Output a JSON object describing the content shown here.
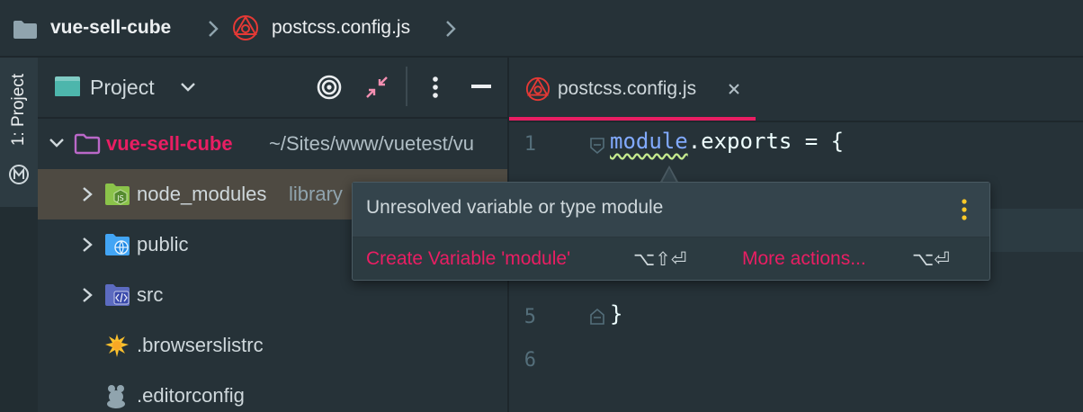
{
  "breadcrumb": {
    "project": "vue-sell-cube",
    "file": "postcss.config.js"
  },
  "toolstrip": {
    "project_tab": "1: Project"
  },
  "project_panel": {
    "title": "Project",
    "tree": [
      {
        "name": "vue-sell-cube",
        "path": "~/Sites/www/vuetest/vu"
      },
      {
        "name": "node_modules",
        "suffix": "library"
      },
      {
        "name": "public"
      },
      {
        "name": "src"
      },
      {
        "name": ".browserslistrc"
      },
      {
        "name": ".editorconfig"
      }
    ]
  },
  "editor": {
    "tab": "postcss.config.js",
    "line_numbers": [
      "1",
      "5",
      "6"
    ],
    "code_module": "module",
    "code_rest": ".exports = {",
    "code_close": "}"
  },
  "popup": {
    "message": "Unresolved variable or type module",
    "action1": "Create Variable 'module'",
    "action1_shortcut": "⌥⇧⏎",
    "action2": "More actions...",
    "action2_shortcut": "⌥⏎"
  },
  "colors": {
    "accent": "#e91e63",
    "folder_blue": "#64b5f6",
    "selection": "#4e4a42"
  }
}
